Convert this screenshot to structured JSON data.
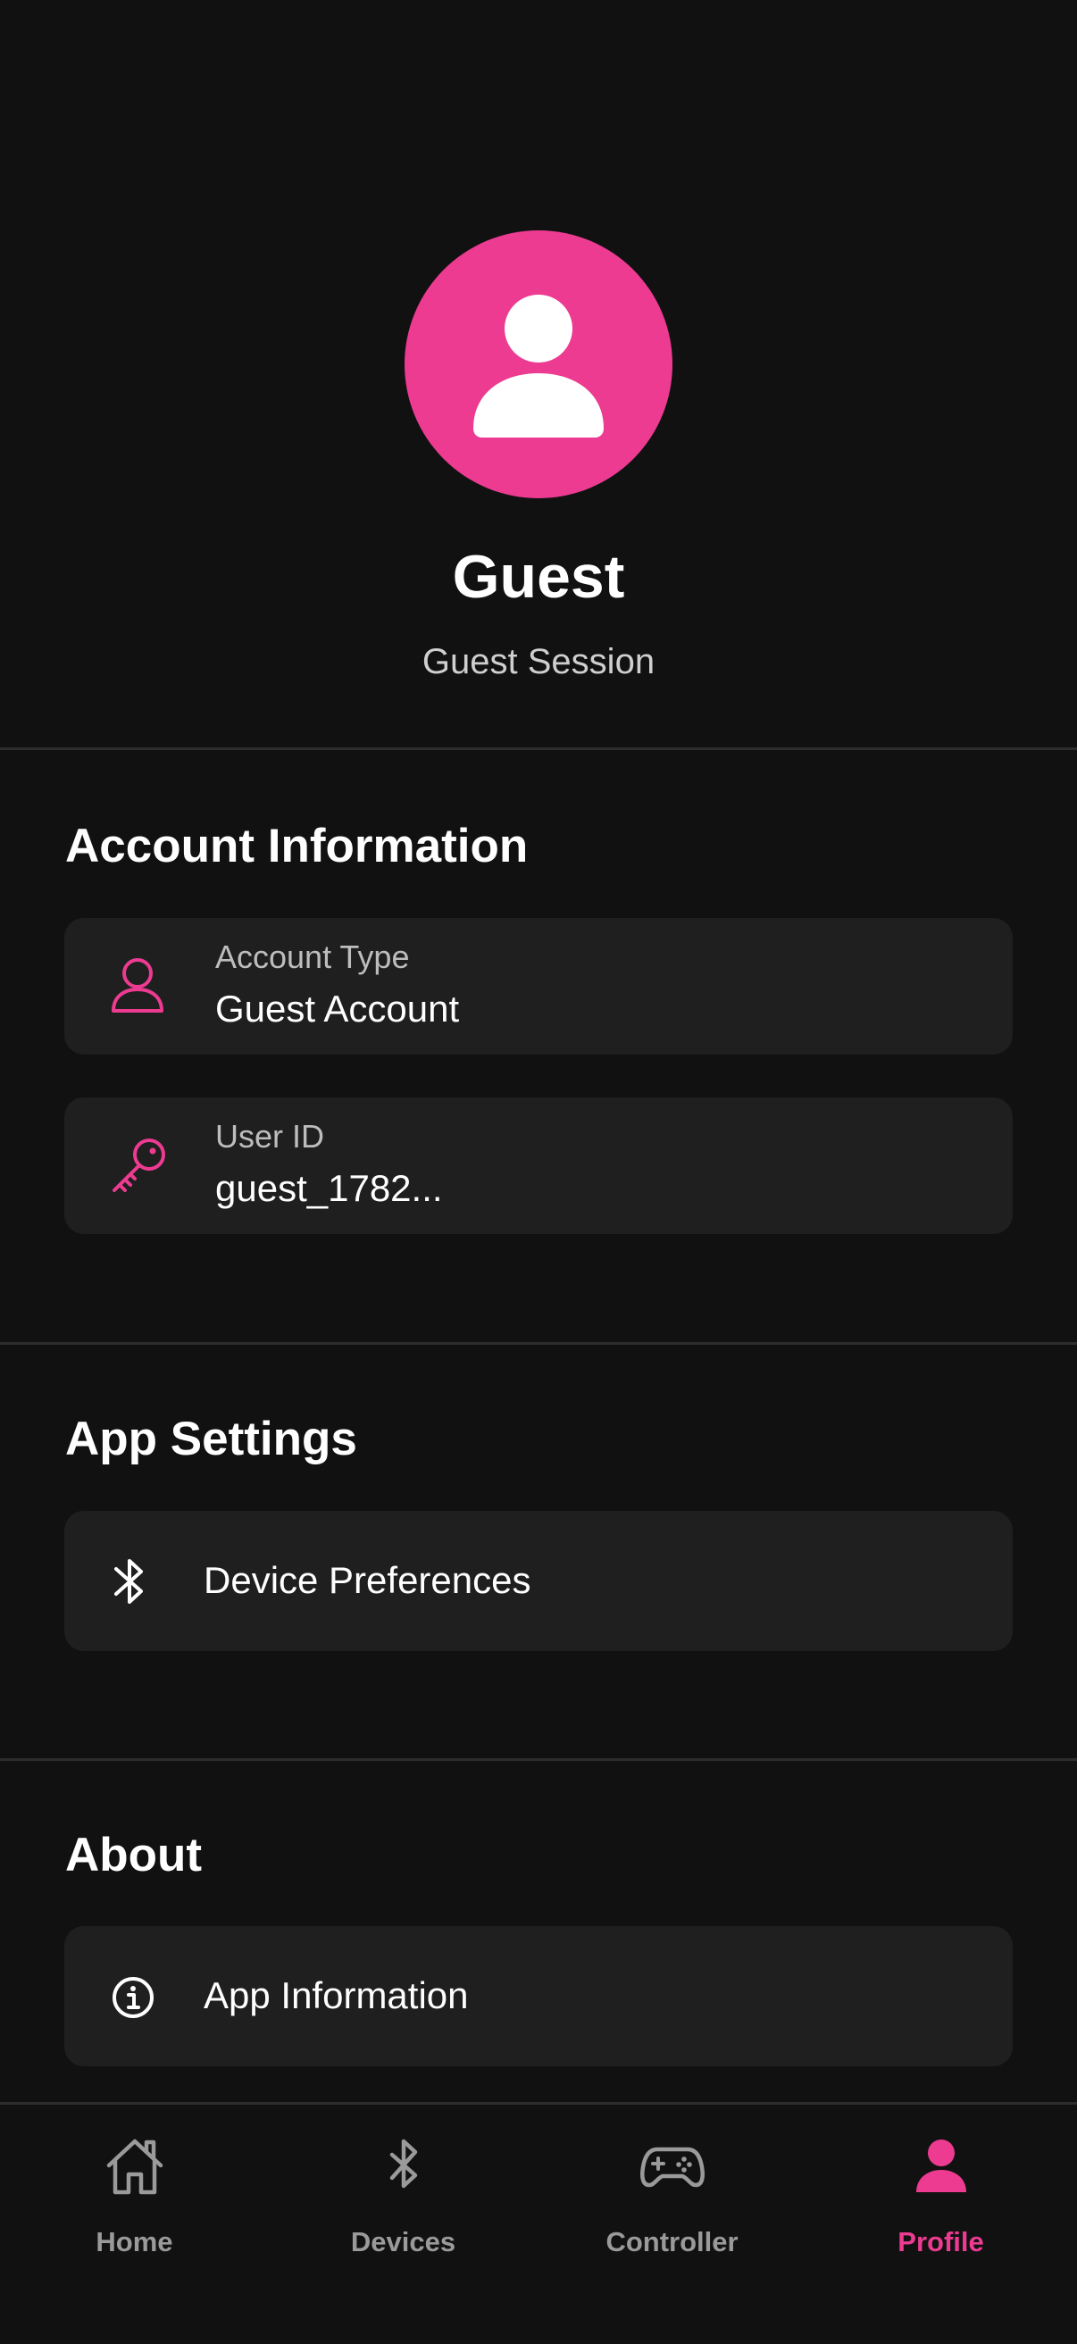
{
  "profile": {
    "name": "Guest",
    "session": "Guest Session"
  },
  "sections": {
    "account": {
      "title": "Account Information",
      "items": [
        {
          "label": "Account Type",
          "value": "Guest Account",
          "icon": "person-outline-icon"
        },
        {
          "label": "User ID",
          "value": "guest_1782...",
          "icon": "key-icon"
        }
      ]
    },
    "settings": {
      "title": "App Settings",
      "items": [
        {
          "label": "Device Preferences",
          "icon": "bluetooth-icon"
        }
      ]
    },
    "about": {
      "title": "About",
      "items": [
        {
          "label": "App Information",
          "icon": "info-icon"
        }
      ]
    }
  },
  "tabbar": {
    "tabs": [
      {
        "label": "Home",
        "icon": "home-icon",
        "active": false
      },
      {
        "label": "Devices",
        "icon": "bluetooth-icon",
        "active": false
      },
      {
        "label": "Controller",
        "icon": "gamepad-icon",
        "active": false
      },
      {
        "label": "Profile",
        "icon": "person-icon",
        "active": true
      }
    ]
  },
  "colors": {
    "accent": "#ec3b91",
    "background": "#111111",
    "card": "#1f1f1f",
    "divider": "#2d2d2d",
    "inactive": "#9a9a9a"
  }
}
